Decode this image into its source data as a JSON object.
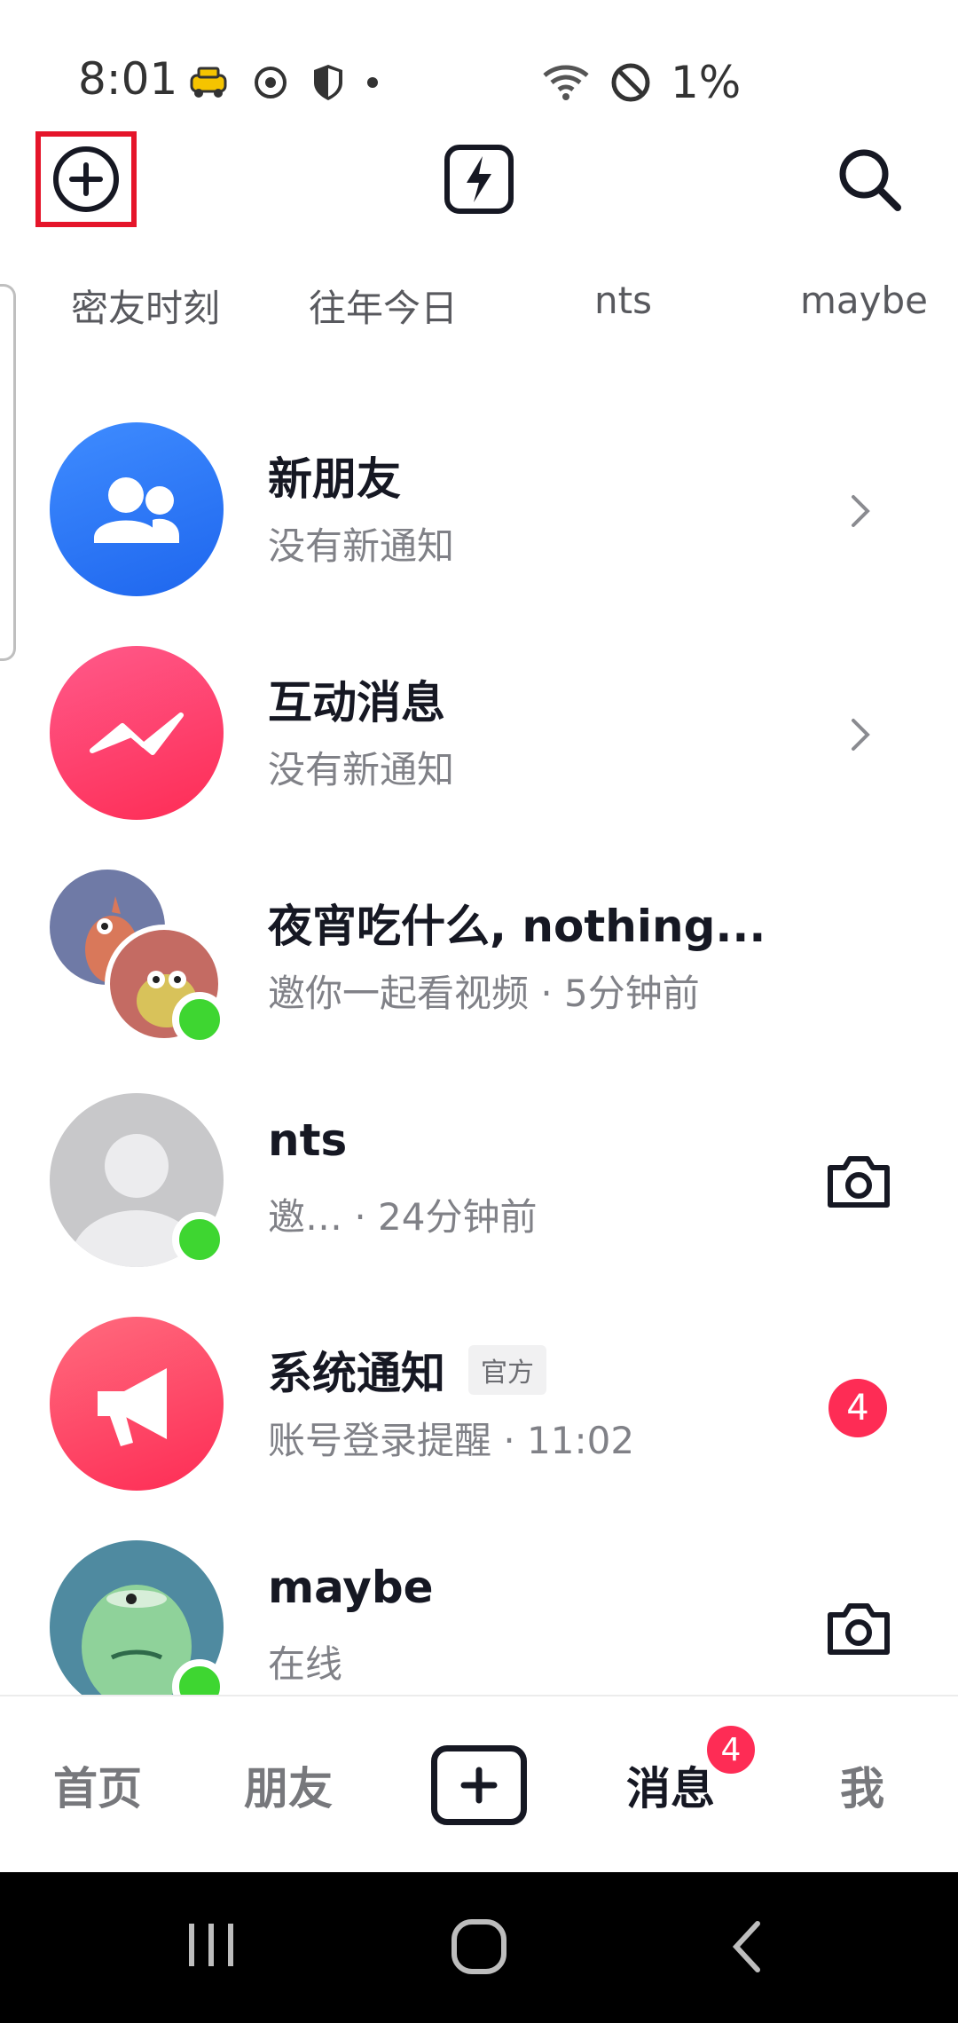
{
  "status_bar": {
    "time": "8:01",
    "battery": "1%",
    "icons": [
      "taxi-icon",
      "sync-icon",
      "shield-icon",
      "dot-icon",
      "wifi-icon",
      "no-signal-icon"
    ]
  },
  "top_nav": {
    "add_icon": "plus-circle-icon",
    "flash_icon": "lightning-icon",
    "search_icon": "search-icon"
  },
  "stories": [
    "密友时刻",
    "往年今日",
    "nts",
    "maybe"
  ],
  "conversations": [
    {
      "title": "新朋友",
      "subtitle": "没有新通知",
      "avatar": "friends-icon",
      "action": "chevron"
    },
    {
      "title": "互动消息",
      "subtitle": "没有新通知",
      "avatar": "interaction-icon",
      "action": "chevron"
    },
    {
      "title": "夜宵吃什么, nothing...",
      "subtitle": "邀你一起看视频 · 5分钟前",
      "avatar": "group-avatar",
      "online": true
    },
    {
      "title": "nts",
      "subtitle": "邀…   · 24分钟前",
      "avatar": "default-avatar",
      "online": true,
      "action": "camera"
    },
    {
      "title": "系统通知",
      "tag": "官方",
      "subtitle": "账号登录提醒 · 11:02",
      "avatar": "megaphone-icon",
      "badge": "4"
    },
    {
      "title": "maybe",
      "subtitle": "在线",
      "avatar": "monster-avatar",
      "online": true,
      "action": "camera"
    }
  ],
  "bottom_nav": {
    "tabs": [
      "首页",
      "朋友",
      "消息",
      "我"
    ],
    "active": "消息",
    "messages_badge": "4",
    "create_icon": "plus-square-icon"
  },
  "colors": {
    "accent_red": "#fe2c55",
    "highlight_box": "#e5152a",
    "online_green": "#3ed631",
    "friends_blue": "#2a7bf6"
  }
}
